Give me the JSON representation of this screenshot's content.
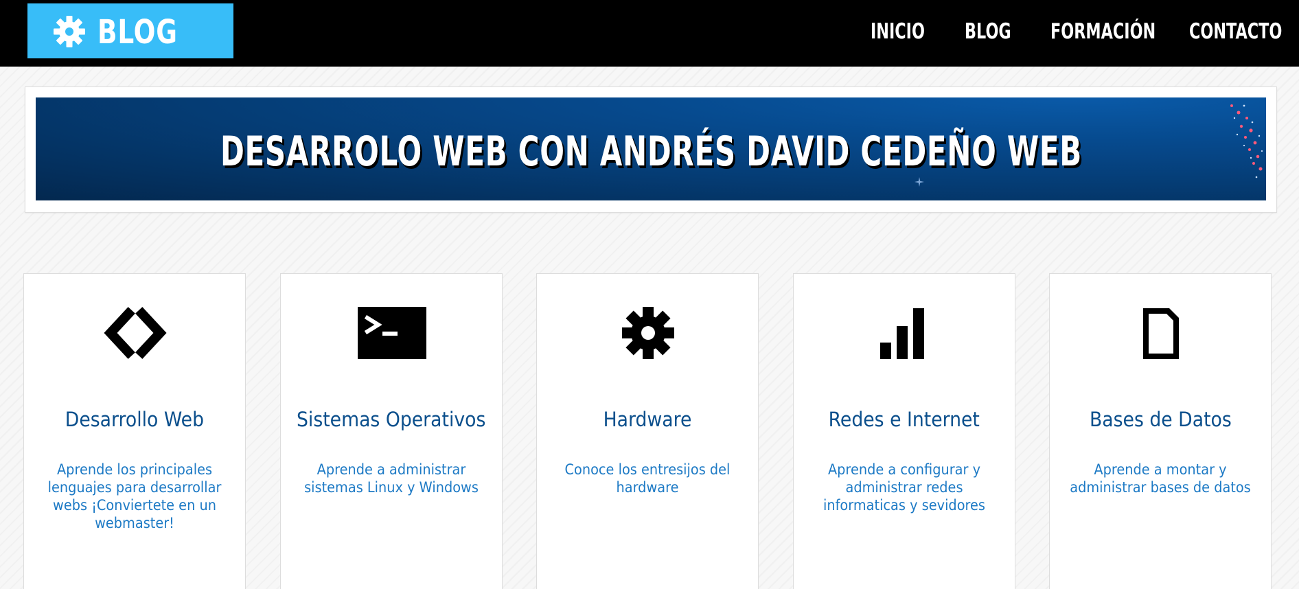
{
  "header": {
    "logo_text": "BLOG",
    "logo_icon": "gear-icon",
    "nav": [
      {
        "label": "INICIO"
      },
      {
        "label": "BLOG"
      },
      {
        "label": "FORMACIÓN"
      },
      {
        "label": "CONTACTO"
      }
    ]
  },
  "banner": {
    "title": "DESARROLO WEB CON ANDRÉS DAVID CEDEÑO WEB"
  },
  "cards": [
    {
      "icon": "code-icon",
      "title": "Desarrollo Web",
      "text": "Aprende los principales lenguajes para desarrollar webs ¡Conviertete en un webmaster!"
    },
    {
      "icon": "terminal-icon",
      "title": "Sistemas Operativos",
      "text": "Aprende a administrar sistemas Linux y Windows"
    },
    {
      "icon": "gear-icon",
      "title": "Hardware",
      "text": "Conoce los entresijos del hardware"
    },
    {
      "icon": "signal-bars-icon",
      "title": "Redes e Internet",
      "text": "Aprende a configurar y administrar redes informaticas y sevidores"
    },
    {
      "icon": "file-icon",
      "title": "Bases de Datos",
      "text": "Aprende a montar y administrar bases de datos"
    }
  ],
  "colors": {
    "topbar": "#000000",
    "logo_bg": "#38bdf8",
    "card_title": "#0b4f8c",
    "card_text": "#1d7ac5",
    "banner_bg": "#053c74"
  }
}
